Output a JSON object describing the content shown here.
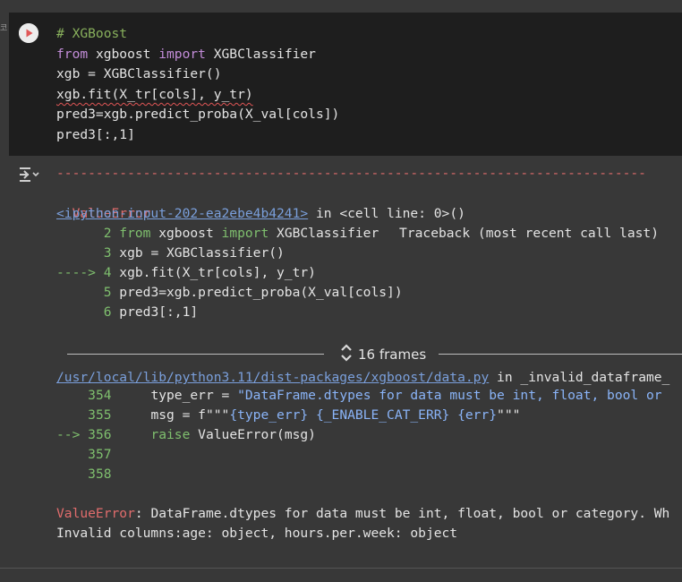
{
  "cell": {
    "run_icon": "play-icon",
    "exec_hint": "코",
    "code_lines": [
      [
        {
          "t": "# XGBoost",
          "c": "comment"
        }
      ],
      [
        {
          "t": "from",
          "c": "kw"
        },
        {
          "t": " xgboost ",
          "c": "text"
        },
        {
          "t": "import",
          "c": "kw"
        },
        {
          "t": " XGBClassifier",
          "c": "text"
        }
      ],
      [
        {
          "t": "xgb = XGBClassifier()",
          "c": "text"
        }
      ],
      [
        {
          "t": "xgb.fit(X_tr[cols], y_tr)",
          "c": "text squiggle"
        }
      ],
      [
        {
          "t": "pred3=xgb.predict_proba(X_val[cols])",
          "c": "text"
        }
      ],
      [
        {
          "t": "pred3[:,1]",
          "c": "text"
        }
      ]
    ]
  },
  "output": {
    "icon": "output-toggle-icon",
    "dash_line": "---------------------------------------------------------------------------",
    "error_name": "ValueError",
    "traceback_label": "Traceback (most recent call last)",
    "input_link": "<ipython-input-202-ea2ebe4b4241>",
    "in_text": " in ",
    "cell_ref": "<cell line: 0>()",
    "context": [
      {
        "arrow": "     ",
        "num": " 2",
        "code": [
          {
            "t": " from",
            "c": "kw2"
          },
          {
            "t": " xgboost ",
            "c": "text"
          },
          {
            "t": "import",
            "c": "kw2"
          },
          {
            "t": " XGBClassifier",
            "c": "text"
          }
        ]
      },
      {
        "arrow": "     ",
        "num": " 3",
        "code": [
          {
            "t": " xgb = XGBClassifier()",
            "c": "text"
          }
        ]
      },
      {
        "arrow": "---->",
        "num": " 4",
        "code": [
          {
            "t": " xgb.fit(X_tr[cols], y_tr)",
            "c": "text"
          }
        ]
      },
      {
        "arrow": "     ",
        "num": " 5",
        "code": [
          {
            "t": " pred3=xgb.predict_proba(X_val[cols])",
            "c": "text"
          }
        ]
      },
      {
        "arrow": "     ",
        "num": " 6",
        "code": [
          {
            "t": " pred3[:,1]",
            "c": "text"
          }
        ]
      }
    ],
    "frames_label": "16 frames",
    "frames_icon": "unfold-icon",
    "file_link": "/usr/local/lib/python3.11/dist-packages/xgboost/data.py",
    "file_in": " in ",
    "file_func": "_invalid_dataframe_",
    "frame_lines": [
      {
        "arrow": "    ",
        "num": "354",
        "code": [
          {
            "t": "     type_err = ",
            "c": "text"
          },
          {
            "t": "\"DataFrame.dtypes for data must be int, float, bool or",
            "c": "str"
          }
        ]
      },
      {
        "arrow": "    ",
        "num": "355",
        "code": [
          {
            "t": "     msg = f\"\"\"",
            "c": "text"
          },
          {
            "t": "{type_err} {_ENABLE_CAT_ERR} {err}",
            "c": "str"
          },
          {
            "t": "\"\"\"",
            "c": "text"
          }
        ]
      },
      {
        "arrow": "--> ",
        "num": "356",
        "code": [
          {
            "t": "     ",
            "c": "text"
          },
          {
            "t": "raise",
            "c": "kw2"
          },
          {
            "t": " ValueError(msg)",
            "c": "text"
          }
        ]
      },
      {
        "arrow": "    ",
        "num": "357",
        "code": []
      },
      {
        "arrow": "    ",
        "num": "358",
        "code": []
      }
    ],
    "final_error_name": "ValueError",
    "final_error_msg": ": DataFrame.dtypes for data must be int, float, bool or category. Wh",
    "invalid_columns": "Invalid columns:age: object, hours.per.week: object"
  }
}
